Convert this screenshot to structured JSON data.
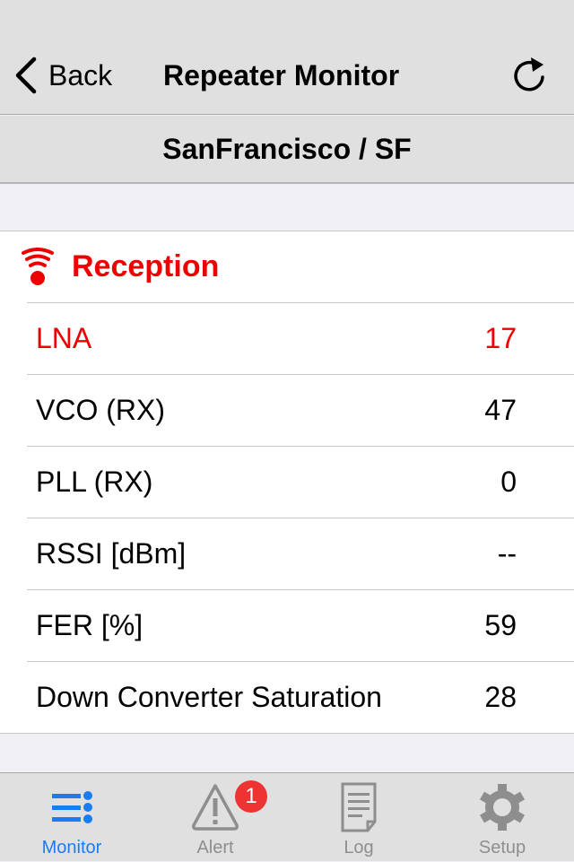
{
  "navbar": {
    "back_label": "Back",
    "title": "Repeater Monitor",
    "refresh_icon": "refresh-icon"
  },
  "subheader": {
    "title": "SanFrancisco / SF"
  },
  "section": {
    "title": "Reception",
    "icon": "reception-signal-icon",
    "color": "#ee0000",
    "rows": [
      {
        "label": "LNA",
        "value": "17",
        "alert": true
      },
      {
        "label": "VCO (RX)",
        "value": "47",
        "alert": false
      },
      {
        "label": "PLL (RX)",
        "value": "0",
        "alert": false
      },
      {
        "label": "RSSI [dBm]",
        "value": "--",
        "alert": false
      },
      {
        "label": "FER [%]",
        "value": "59",
        "alert": false
      },
      {
        "label": "Down Converter Saturation",
        "value": "28",
        "alert": false
      }
    ]
  },
  "tabbar": {
    "active_color": "#1a7cf4",
    "inactive_color": "#8e8e8e",
    "tabs": [
      {
        "label": "Monitor",
        "icon": "list-icon",
        "active": true
      },
      {
        "label": "Alert",
        "icon": "warning-icon",
        "active": false,
        "badge": "1"
      },
      {
        "label": "Log",
        "icon": "document-icon",
        "active": false
      },
      {
        "label": "Setup",
        "icon": "gear-icon",
        "active": false
      }
    ]
  }
}
